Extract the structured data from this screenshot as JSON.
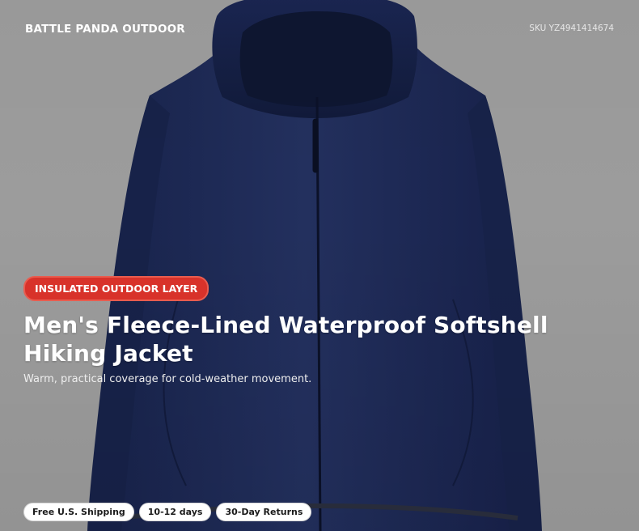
{
  "header": {
    "brand": "BATTLE PANDA OUTDOOR",
    "sku": "SKU YZ4941414674"
  },
  "hero": {
    "image_name": "navy-softshell-hooded-jacket",
    "background_color": "#9c9c9c",
    "jacket_color": "#1d2a55"
  },
  "product": {
    "tag": "INSULATED OUTDOOR LAYER",
    "title": "Men's Fleece-Lined Waterproof Softshell Hiking Jacket",
    "subtitle": "Warm, practical coverage for cold-weather movement.",
    "tag_color": "#d8322a"
  },
  "features": [
    "Free U.S. Shipping",
    "10-12 days",
    "30-Day Returns"
  ]
}
